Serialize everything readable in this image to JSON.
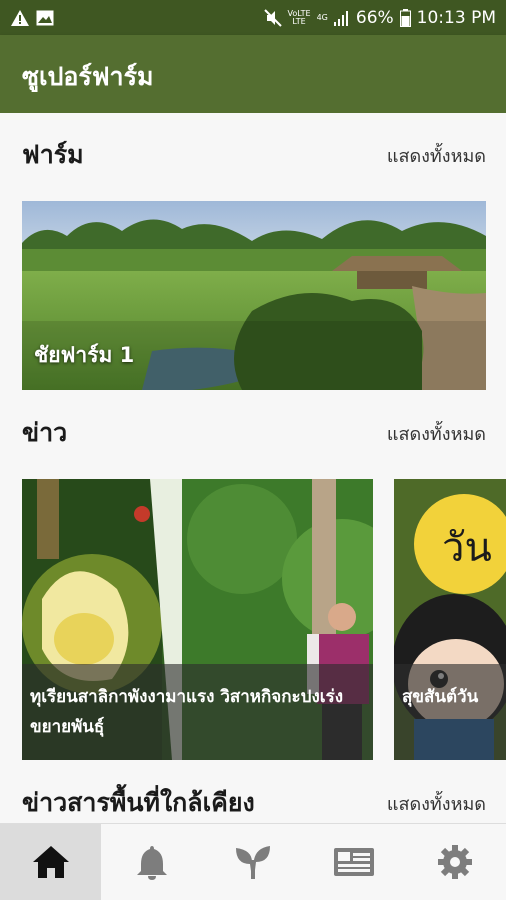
{
  "status_bar": {
    "battery": "66%",
    "time": "10:13 PM",
    "volte_top": "VoLTE",
    "volte_bottom": "LTE",
    "net_label": "4G"
  },
  "app_bar": {
    "title": "ซูเปอร์ฟาร์ม"
  },
  "sections": {
    "farm": {
      "title": "ฟาร์ม",
      "show_all": "แสดงทั้งหมด",
      "items": [
        {
          "name": "ชัยฟาร์ม 1"
        }
      ]
    },
    "news": {
      "title": "ข่าว",
      "show_all": "แสดงทั้งหมด",
      "items": [
        {
          "caption": "ทุเรียนสาลิกาพังงามาแรง วิสาหกิจกะปงเร่งขยายพันธุ์"
        },
        {
          "caption": "สุขสันต์วัน"
        }
      ],
      "partial_text": "วัน"
    },
    "nearby": {
      "title": "ข่าวสารพื้นที่ใกล้เคียง",
      "show_all": "แสดงทั้งหมด"
    }
  },
  "bottom_nav": {
    "items": [
      {
        "icon": "home-icon",
        "active": true
      },
      {
        "icon": "bell-icon",
        "active": false
      },
      {
        "icon": "sprout-icon",
        "active": false
      },
      {
        "icon": "newspaper-icon",
        "active": false
      },
      {
        "icon": "gear-icon",
        "active": false
      }
    ]
  },
  "colors": {
    "status_bar": "#3f5722",
    "app_bar": "#546e30",
    "nav_icon": "#7d7d7d",
    "nav_icon_active": "#111111"
  }
}
